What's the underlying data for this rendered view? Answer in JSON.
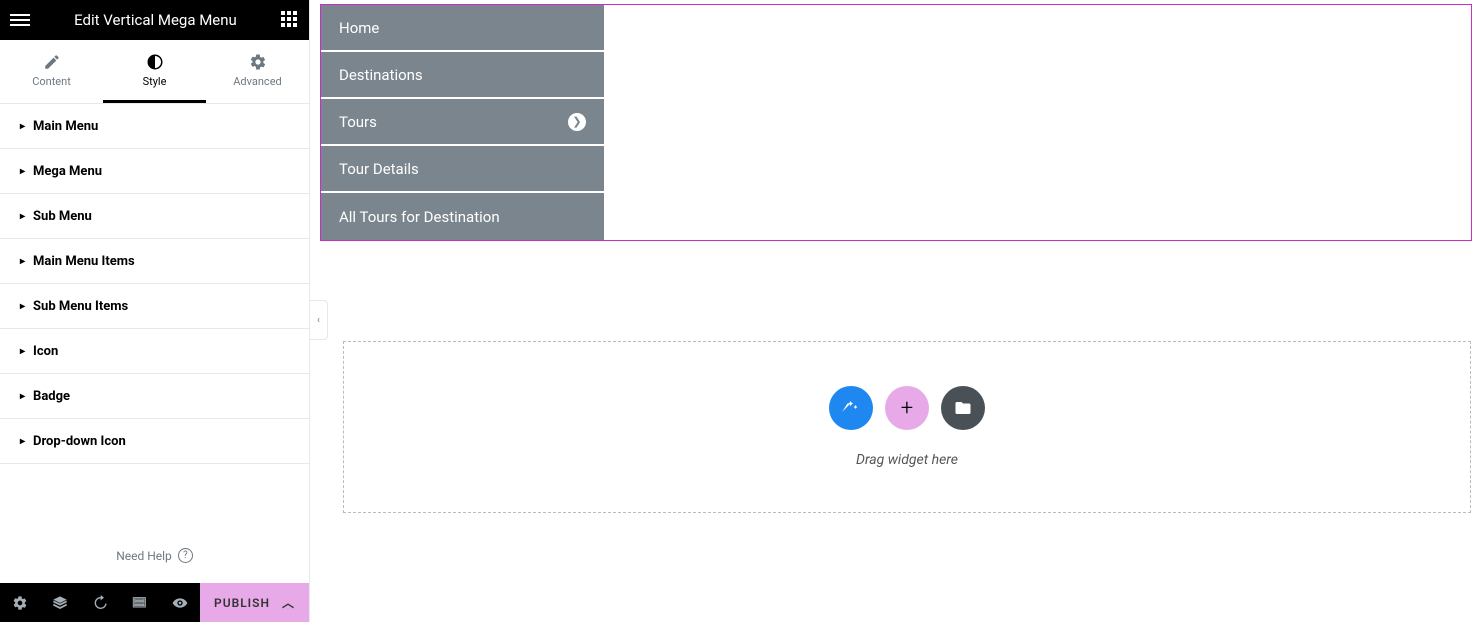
{
  "header": {
    "title": "Edit Vertical Mega Menu"
  },
  "tabs": {
    "content": "Content",
    "style": "Style",
    "advanced": "Advanced"
  },
  "sections": [
    "Main Menu",
    "Mega Menu",
    "Sub Menu",
    "Main Menu Items",
    "Sub Menu Items",
    "Icon",
    "Badge",
    "Drop-down Icon"
  ],
  "help": "Need Help",
  "footer": {
    "publish": "PUBLISH"
  },
  "menu": {
    "items": [
      {
        "label": "Home",
        "hasSub": false
      },
      {
        "label": "Destinations",
        "hasSub": false
      },
      {
        "label": "Tours",
        "hasSub": true
      },
      {
        "label": "Tour Details",
        "hasSub": false
      },
      {
        "label": "All Tours for Destination",
        "hasSub": false
      }
    ]
  },
  "dropzone": {
    "hint": "Drag widget here"
  }
}
